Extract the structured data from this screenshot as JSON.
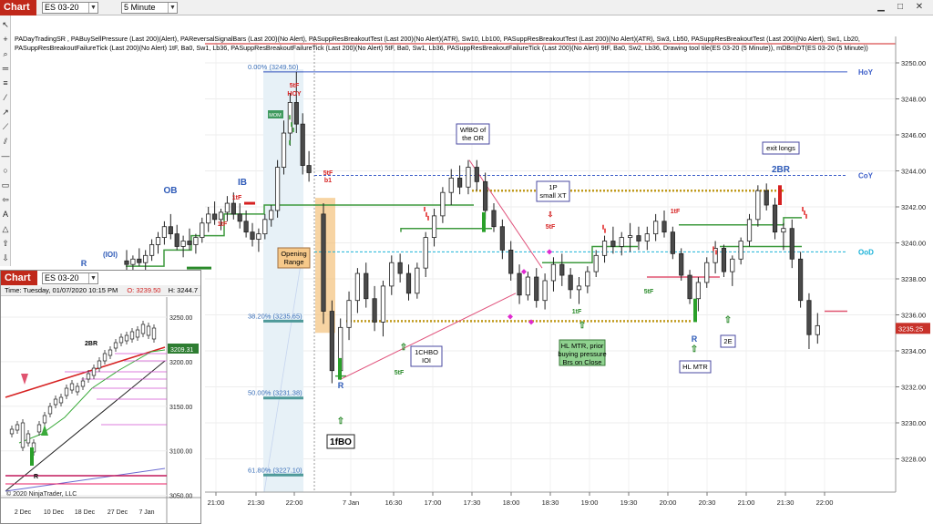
{
  "app": {
    "tab_label": "Chart",
    "instrument": "ES 03-20",
    "interval": "5 Minute"
  },
  "indicators_line1": "PADayTradingSR , PABuySellPressure (Last 200)(Alert), PAReversalSignalBars (Last 200)(No Alert), PASuppResBreakoutTest (Last 200)(No Alert)(ATR),  Sw10,  Lb100, PASuppResBreakoutTest (Last 200)(No Alert)(ATR),  Sw3,  Lb50, PASuppResBreakoutTest (Last 200)(No Alert),  Sw1,  Lb20,",
  "indicators_line2": "PASuppResBreakoutFailureTick (Last 200)(No Alert) 1tF,  Ba0,  Sw1,  Lb36, PASuppResBreakoutFailureTick (Last 200)(No Alert) 5tF,  Ba0,  Sw1,  Lb36, PASuppResBreakoutFailureTick (Last 200)(No Alert) 9tF,  Ba0,  Sw2,  Lb36, Drawing tool tile(ES 03-20 (5 Minute)), mDBmDT(ES 03-20 (5 Minute))",
  "chart_data": {
    "type": "candlestick",
    "y_ticks": [
      "3250.00",
      "3248.00",
      "3246.00",
      "3244.00",
      "3242.00",
      "3240.00",
      "3238.00",
      "3236.00",
      "3234.00",
      "3232.00",
      "3230.00",
      "3228.00"
    ],
    "x_ticks": [
      "21:00",
      "21:30",
      "22:00",
      "7 Jan",
      "16:30",
      "17:00",
      "17:30",
      "18:00",
      "18:30",
      "19:00",
      "19:30",
      "20:00",
      "20:30",
      "21:00",
      "21:30",
      "22:00"
    ],
    "last_price": "3235.25",
    "fib_levels": [
      "0.00% (3249.50)",
      "38.20% (3235.65)",
      "50.00% (3231.38)",
      "61.80% (3227.10)"
    ],
    "levels": [
      {
        "name": "HoY",
        "value": 3249.5,
        "color": "#3c5ec9"
      },
      {
        "name": "CoY",
        "value": 3243.75,
        "color": "#3c5ec9"
      },
      {
        "name": "OoD",
        "value": 3239.5,
        "color": "#1ab2d8"
      }
    ],
    "candles": [
      [
        3239,
        3239.6,
        3238.4,
        3238.8
      ],
      [
        3238.8,
        3239.3,
        3238.3,
        3239.1
      ],
      [
        3239.1,
        3239.7,
        3238.7,
        3238.9
      ],
      [
        3238.9,
        3239.6,
        3238.5,
        3239.3
      ],
      [
        3239.3,
        3240.2,
        3239,
        3239.9
      ],
      [
        3239.9,
        3240.6,
        3239.4,
        3240.3
      ],
      [
        3240.3,
        3241.2,
        3239.9,
        3240.9
      ],
      [
        3240.9,
        3241.6,
        3240.2,
        3240.5
      ],
      [
        3240.5,
        3241,
        3239.6,
        3239.8
      ],
      [
        3239.8,
        3240.4,
        3239.2,
        3240.1
      ],
      [
        3240.1,
        3240.8,
        3239.6,
        3239.9
      ],
      [
        3239.9,
        3240.5,
        3239.4,
        3240.3
      ],
      [
        3240.3,
        3241.4,
        3240,
        3241.1
      ],
      [
        3241.1,
        3242,
        3240.6,
        3241.6
      ],
      [
        3241.6,
        3242.3,
        3241,
        3241.3
      ],
      [
        3241.3,
        3241.9,
        3240.7,
        3241.7
      ],
      [
        3241.7,
        3242.6,
        3241.2,
        3242.2
      ],
      [
        3242.2,
        3242.8,
        3241.3,
        3241.6
      ],
      [
        3241.6,
        3242.2,
        3240.8,
        3241.2
      ],
      [
        3241.2,
        3241.8,
        3240.3,
        3240.6
      ],
      [
        3240.6,
        3241.1,
        3239.8,
        3240.2
      ],
      [
        3240.2,
        3240.8,
        3239.5,
        3240.5
      ],
      [
        3240.5,
        3241.6,
        3240.2,
        3241.3
      ],
      [
        3241.3,
        3242.1,
        3240.9,
        3241.8
      ],
      [
        3241.8,
        3244.6,
        3241.4,
        3244.2
      ],
      [
        3244.2,
        3246.8,
        3243.8,
        3246.1
      ],
      [
        3246.1,
        3248.3,
        3245.4,
        3247.8
      ],
      [
        3247.8,
        3249.5,
        3246.1,
        3246.6
      ],
      [
        3246.6,
        3247.2,
        3243.8,
        3244.3
      ],
      [
        3244.3,
        3245.1,
        3243.4,
        3243.9
      ],
      [
        3241.6,
        3242.2,
        3235.5,
        3236.2
      ],
      [
        3236.2,
        3236.8,
        3232.2,
        3232.9
      ],
      [
        3232.9,
        3235.8,
        3232.4,
        3235.3
      ],
      [
        3235.3,
        3237.3,
        3234.6,
        3236.8
      ],
      [
        3236.8,
        3238.6,
        3236.1,
        3238.3
      ],
      [
        3238.3,
        3238.9,
        3236.4,
        3236.9
      ],
      [
        3236.9,
        3237.6,
        3235.1,
        3235.6
      ],
      [
        3235.6,
        3237.9,
        3234.8,
        3237.6
      ],
      [
        3237.6,
        3239.3,
        3237.1,
        3238.9
      ],
      [
        3238.9,
        3239.4,
        3237.8,
        3238.3
      ],
      [
        3238.3,
        3238.8,
        3236.8,
        3237.2
      ],
      [
        3237.2,
        3238.9,
        3236.9,
        3238.6
      ],
      [
        3238.6,
        3240.6,
        3238.1,
        3240.3
      ],
      [
        3240.3,
        3241.9,
        3239.8,
        3241.5
      ],
      [
        3241.5,
        3243.1,
        3241.1,
        3242.8
      ],
      [
        3242.8,
        3244.1,
        3242.1,
        3243.6
      ],
      [
        3243.6,
        3244.3,
        3242.7,
        3243.1
      ],
      [
        3243.1,
        3244.6,
        3242.7,
        3244.2
      ],
      [
        3244.2,
        3244.6,
        3242.9,
        3243.4
      ],
      [
        3243.4,
        3243.9,
        3241.3,
        3241.8
      ],
      [
        3241.8,
        3242.2,
        3240.6,
        3240.9
      ],
      [
        3240.9,
        3241.3,
        3239.1,
        3239.6
      ],
      [
        3239.6,
        3240.1,
        3237.9,
        3238.3
      ],
      [
        3238.3,
        3238.8,
        3236.6,
        3237.1
      ],
      [
        3237.1,
        3238.4,
        3236.8,
        3238.1
      ],
      [
        3238.1,
        3238.6,
        3236.4,
        3236.8
      ],
      [
        3236.8,
        3238.3,
        3236.3,
        3237.9
      ],
      [
        3237.9,
        3239.2,
        3237.3,
        3238.8
      ],
      [
        3238.8,
        3239.4,
        3237.6,
        3238.2
      ],
      [
        3238.2,
        3238.6,
        3236.9,
        3237.4
      ],
      [
        3237.4,
        3238.1,
        3236.6,
        3237.6
      ],
      [
        3237.6,
        3238.7,
        3237.2,
        3238.4
      ],
      [
        3238.4,
        3239.6,
        3238.1,
        3239.3
      ],
      [
        3239.3,
        3240.4,
        3238.9,
        3240.1
      ],
      [
        3240.1,
        3240.9,
        3239.4,
        3239.8
      ],
      [
        3239.8,
        3240.6,
        3239.3,
        3240.3
      ],
      [
        3240.3,
        3241.1,
        3239.5,
        3240.4
      ],
      [
        3240.4,
        3240.9,
        3239.6,
        3240.1
      ],
      [
        3240.1,
        3240.9,
        3239.6,
        3240.5
      ],
      [
        3240.5,
        3241.6,
        3240.1,
        3241.2
      ],
      [
        3241.2,
        3241.8,
        3240.3,
        3240.6
      ],
      [
        3240.6,
        3240.9,
        3239.1,
        3239.4
      ],
      [
        3239.4,
        3239.7,
        3237.9,
        3238.2
      ],
      [
        3238.2,
        3238.5,
        3236.6,
        3236.9
      ],
      [
        3236.9,
        3238.1,
        3236.2,
        3237.8
      ],
      [
        3237.8,
        3239.2,
        3237.5,
        3238.9
      ],
      [
        3238.9,
        3240.1,
        3238.3,
        3239.7
      ],
      [
        3239.7,
        3239.9,
        3238.1,
        3238.4
      ],
      [
        3238.4,
        3239.3,
        3237.6,
        3239.1
      ],
      [
        3239.1,
        3240.3,
        3238.8,
        3240.1
      ],
      [
        3240.1,
        3241.6,
        3239.8,
        3241.3
      ],
      [
        3241.3,
        3243.2,
        3240.9,
        3242.9
      ],
      [
        3242.9,
        3243.3,
        3241.8,
        3242.1
      ],
      [
        3242.1,
        3242.5,
        3240.2,
        3240.6
      ],
      [
        3240.6,
        3241.1,
        3239.6,
        3240.8
      ],
      [
        3240.8,
        3241.3,
        3238.6,
        3239.1
      ],
      [
        3239.1,
        3239.5,
        3236.4,
        3236.8
      ],
      [
        3236.8,
        3237.2,
        3234.1,
        3234.9
      ],
      [
        3234.9,
        3236.1,
        3234.4,
        3235.4
      ]
    ],
    "annotations": {
      "OB": "OB",
      "IOI_left": "(IOI)",
      "R_left": "R",
      "IB": "IB",
      "tag_1tF": "1tF",
      "tag_5tF": "5tF",
      "tag_HOY": "HOY",
      "tag_b1": "b1",
      "MOM": "MOM",
      "opening_range": [
        "Opening",
        "Range"
      ],
      "wfbo": [
        "WfBO of",
        "the OR"
      ],
      "p1": [
        "1P",
        "small XT"
      ],
      "chbo": [
        "1CHBO",
        "IOI"
      ],
      "hlmtr_box": [
        "HL MTR, prior",
        "buying pressure",
        "Brs on Close"
      ],
      "hl_mtr": "HL MTR",
      "r_label": "R",
      "e2": "2E",
      "bo1": "1fBO",
      "bo2": "2BR",
      "exit": "exit longs",
      "tag_9tF": "1tF"
    },
    "title": "",
    "xlabel": "",
    "ylabel": "",
    "grid": true
  },
  "mini": {
    "tab_label": "Chart",
    "instrument": "ES 03-20",
    "time_label": "Time: Tuesday, 01/07/2020 10:15 PM",
    "o_label": "O: 3239.50",
    "h_label": "H: 3244.7",
    "price_tag": "3209.31",
    "copyright": "© 2020 NinjaTrader, LLC",
    "label_2br": "2BR",
    "label_r": "R",
    "y_ticks": [
      "3250.00",
      "3200.00",
      "3150.00",
      "3100.00",
      "3050.00"
    ],
    "x_ticks": [
      "2 Dec",
      "10 Dec",
      "18 Dec",
      "27 Dec",
      "7 Jan"
    ]
  }
}
